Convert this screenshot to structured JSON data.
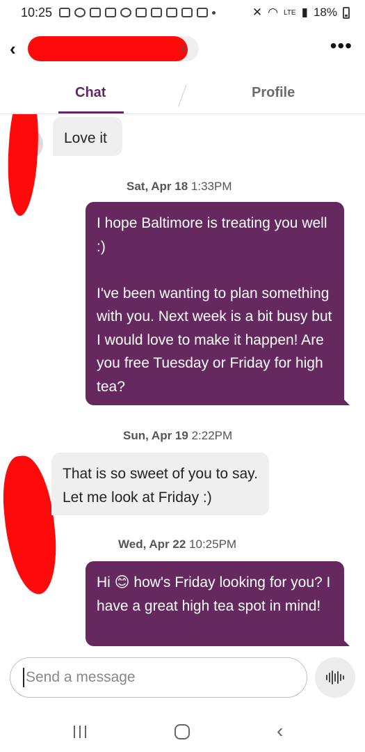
{
  "status_bar": {
    "time": "10:25",
    "network": "LTE",
    "battery": "18%"
  },
  "header": {
    "match_name_suffix": "s",
    "back_icon": "chevron-left-icon",
    "more_icon": "more-horizontal-icon"
  },
  "tabs": [
    {
      "label": "Chat",
      "active": true
    },
    {
      "label": "Profile",
      "active": false
    }
  ],
  "messages": [
    {
      "direction": "in",
      "text": "Love it"
    },
    {
      "timestamp_day": "Sat, Apr 18",
      "timestamp_time": "1:33PM"
    },
    {
      "direction": "out",
      "text": "I hope Baltimore is treating you well :)\n\nI've been wanting to plan something with you. Next week is a bit busy but I would love to make it happen! Are you free Tuesday or Friday for high tea?"
    },
    {
      "timestamp_day": "Sun, Apr 19",
      "timestamp_time": "2:22PM"
    },
    {
      "direction": "in",
      "text": "That is so sweet of you to say. Let me look at Friday :)"
    },
    {
      "timestamp_day": "Wed, Apr 22",
      "timestamp_time": "10:25PM"
    },
    {
      "direction": "out",
      "text": "Hi 😊 how's Friday looking for you? I have a great high tea spot in mind!"
    }
  ],
  "composer": {
    "placeholder": "Send a message",
    "voice_icon": "voice-waveform-icon"
  },
  "colors": {
    "accent": "#5f2a62",
    "outgoing_bubble": "#65285f",
    "incoming_bubble": "#efefef",
    "redaction": "#ff0a0a"
  }
}
